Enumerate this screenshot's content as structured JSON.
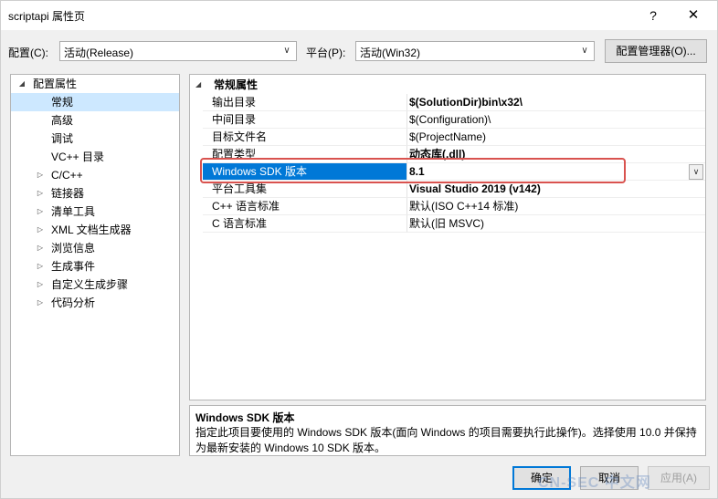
{
  "window": {
    "title": "scriptapi 属性页",
    "help_label": "?",
    "close_label": "✕"
  },
  "config_bar": {
    "config_label": "配置(C):",
    "config_value": "活动(Release)",
    "platform_label": "平台(P):",
    "platform_value": "活动(Win32)",
    "manager_label": "配置管理器(O)..."
  },
  "tree": {
    "items": [
      {
        "label": "配置属性",
        "expander": "◢"
      },
      {
        "label": "常规",
        "expander": ""
      },
      {
        "label": "高级",
        "expander": ""
      },
      {
        "label": "调试",
        "expander": ""
      },
      {
        "label": "VC++ 目录",
        "expander": ""
      },
      {
        "label": "C/C++",
        "expander": "▷"
      },
      {
        "label": "链接器",
        "expander": "▷"
      },
      {
        "label": "清单工具",
        "expander": "▷"
      },
      {
        "label": "XML 文档生成器",
        "expander": "▷"
      },
      {
        "label": "浏览信息",
        "expander": "▷"
      },
      {
        "label": "生成事件",
        "expander": "▷"
      },
      {
        "label": "自定义生成步骤",
        "expander": "▷"
      },
      {
        "label": "代码分析",
        "expander": "▷"
      }
    ]
  },
  "grid": {
    "category": "常规属性",
    "category_expander": "◢",
    "rows": [
      {
        "name": "输出目录",
        "value": "$(SolutionDir)bin\\x32\\"
      },
      {
        "name": "中间目录",
        "value": "$(Configuration)\\"
      },
      {
        "name": "目标文件名",
        "value": "$(ProjectName)"
      },
      {
        "name": "配置类型",
        "value": "动态库(.dll)"
      },
      {
        "name": "Windows SDK 版本",
        "value": "8.1"
      },
      {
        "name": "平台工具集",
        "value": "Visual Studio 2019 (v142)"
      },
      {
        "name": "C++ 语言标准",
        "value": "默认(ISO C++14 标准)"
      },
      {
        "name": "C 语言标准",
        "value": "默认(旧 MSVC)"
      }
    ],
    "dropdown_glyph": "∨"
  },
  "description": {
    "title": "Windows SDK 版本",
    "text": "指定此项目要使用的 Windows SDK 版本(面向 Windows 的项目需要执行此操作)。选择使用 10.0 并保持为最新安装的 Windows 10 SDK 版本。"
  },
  "buttons": {
    "ok": "确定",
    "cancel": "取消",
    "apply": "应用(A)"
  },
  "watermark": "CN-SEC 中文网",
  "colors": {
    "selection": "#0078d7",
    "tree_selection": "#cde8ff",
    "highlight": "#d9534f"
  }
}
